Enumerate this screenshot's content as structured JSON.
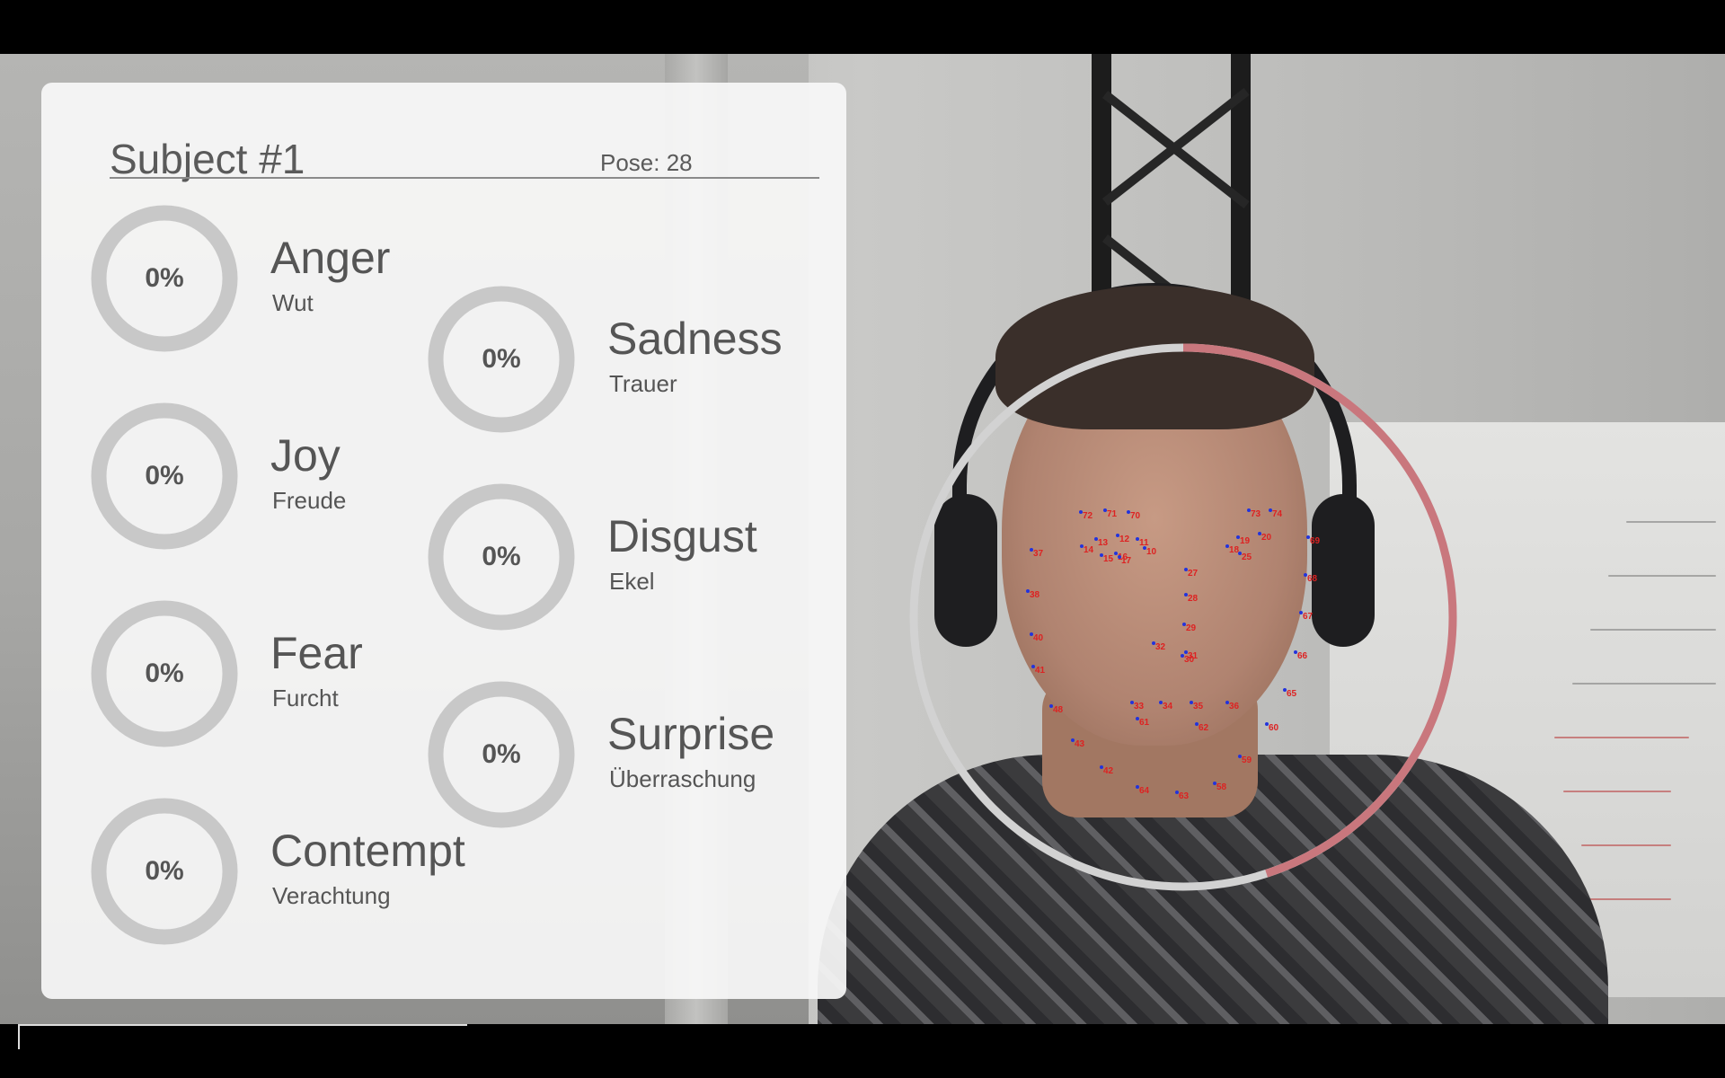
{
  "panel": {
    "subject_title": "Subject #1",
    "pose_label": "Pose: 28"
  },
  "emotions": [
    {
      "name": "Anger",
      "sub": "Wut",
      "value": "0%"
    },
    {
      "name": "Sadness",
      "sub": "Trauer",
      "value": "0%"
    },
    {
      "name": "Joy",
      "sub": "Freude",
      "value": "0%"
    },
    {
      "name": "Disgust",
      "sub": "Ekel",
      "value": "0%"
    },
    {
      "name": "Fear",
      "sub": "Furcht",
      "value": "0%"
    },
    {
      "name": "Surprise",
      "sub": "Überraschung",
      "value": "0%"
    },
    {
      "name": "Contempt",
      "sub": "Verachtung",
      "value": "0%"
    }
  ],
  "face_tracker": {
    "progress_fraction": 0.45,
    "ring_color": "#c9777d",
    "track_color": "#d2d2d2",
    "landmarks": [
      "72",
      "71",
      "70",
      "73",
      "74",
      "13",
      "12",
      "11",
      "19",
      "20",
      "14",
      "16",
      "10",
      "18",
      "25",
      "15",
      "17",
      "27",
      "69",
      "28",
      "68",
      "29",
      "30",
      "67",
      "32",
      "31",
      "66",
      "65",
      "33",
      "34",
      "35",
      "36",
      "37",
      "38",
      "40",
      "41",
      "48",
      "43",
      "42",
      "64",
      "63",
      "58",
      "59",
      "60",
      "61",
      "62"
    ]
  },
  "colors": {
    "donut_track": "#c8c8c8",
    "text": "#555555"
  }
}
